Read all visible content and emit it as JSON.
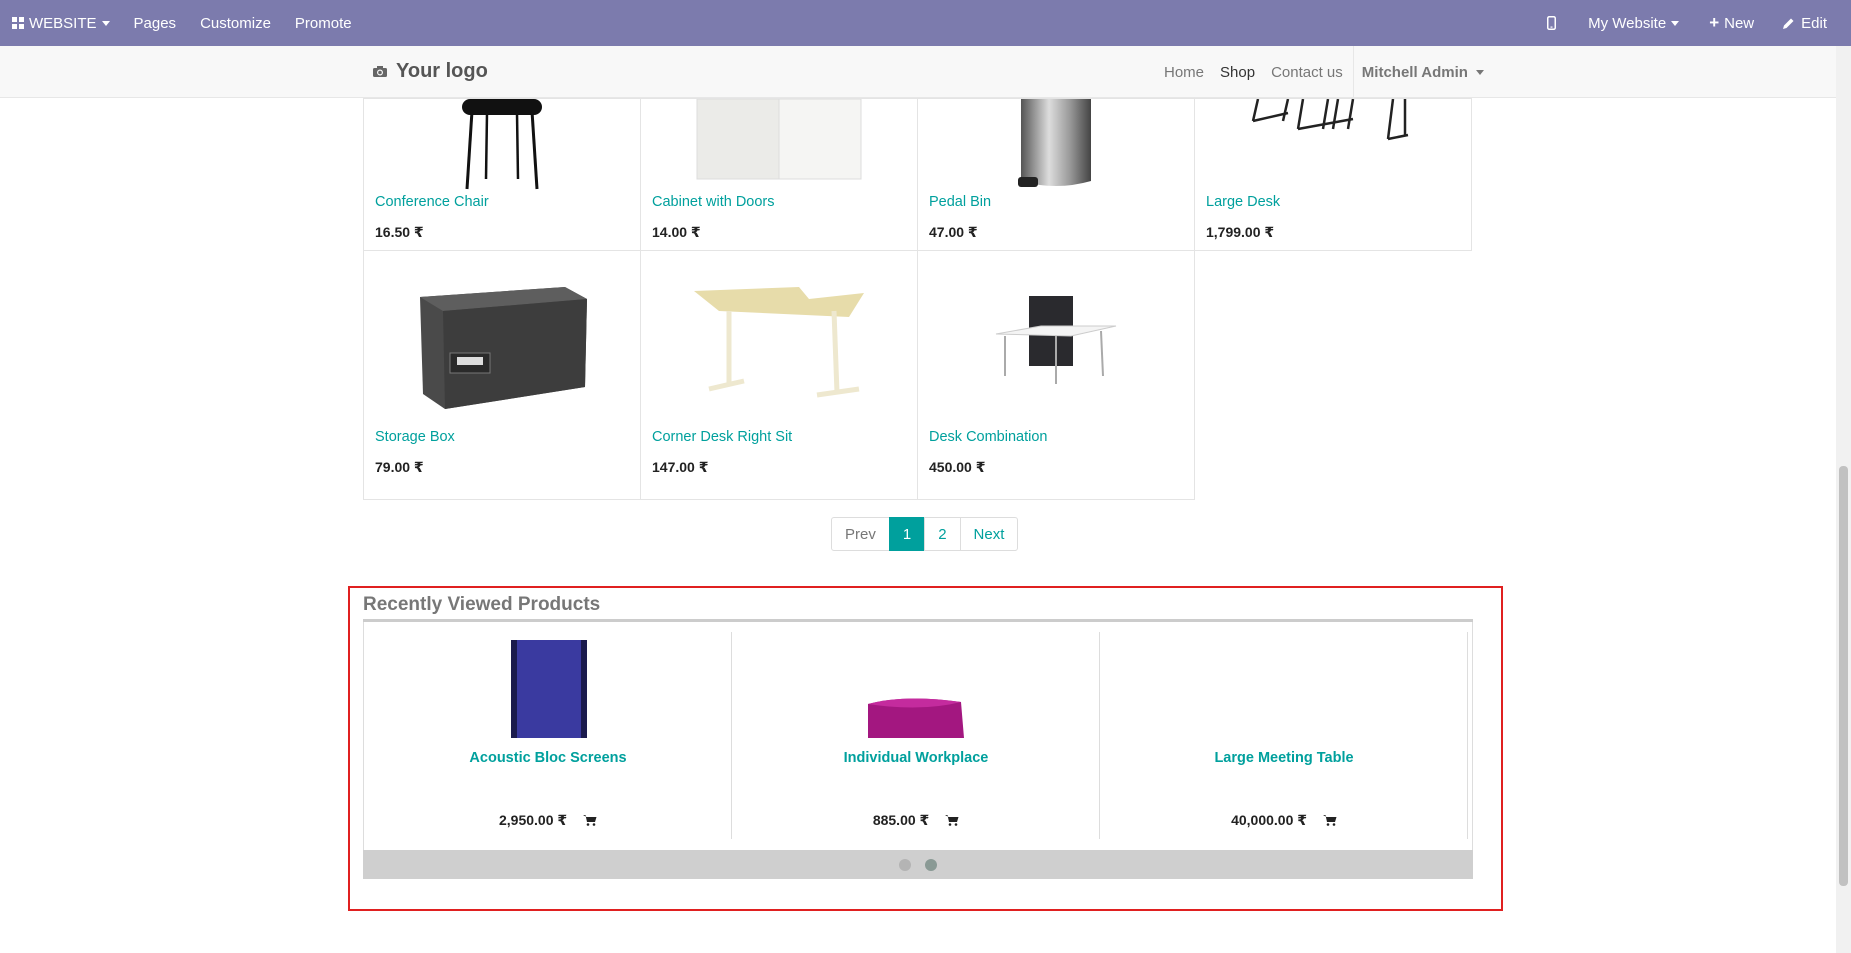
{
  "admin_bar": {
    "website_label": "WEBSITE",
    "pages_label": "Pages",
    "customize_label": "Customize",
    "promote_label": "Promote",
    "my_website_label": "My Website",
    "new_label": "New",
    "edit_label": "Edit"
  },
  "header": {
    "logo_text": "Your logo",
    "nav": {
      "home": "Home",
      "shop": "Shop",
      "contact": "Contact us",
      "user": "Mitchell Admin"
    }
  },
  "products": [
    {
      "name": "Conference Chair",
      "price": "16.50 ₹"
    },
    {
      "name": "Cabinet with Doors",
      "price": "14.00 ₹"
    },
    {
      "name": "Pedal Bin",
      "price": "47.00 ₹"
    },
    {
      "name": "Large Desk",
      "price": "1,799.00 ₹"
    },
    {
      "name": "Storage Box",
      "price": "79.00 ₹"
    },
    {
      "name": "Corner Desk Right Sit",
      "price": "147.00 ₹"
    },
    {
      "name": "Desk Combination",
      "price": "450.00 ₹"
    }
  ],
  "pager": {
    "prev": "Prev",
    "page1": "1",
    "page2": "2",
    "next": "Next"
  },
  "recently_viewed": {
    "title": "Recently Viewed Products",
    "items": [
      {
        "name": "Acoustic Bloc Screens",
        "price": "2,950.00 ₹"
      },
      {
        "name": "Individual Workplace",
        "price": "885.00 ₹"
      },
      {
        "name": "Large Meeting Table",
        "price": "40,000.00 ₹"
      }
    ],
    "active_slide": 2,
    "slide_count": 2
  },
  "colors": {
    "admin_bar": "#7c7bad",
    "accent": "#00a09d",
    "highlight_frame": "#e02020"
  }
}
